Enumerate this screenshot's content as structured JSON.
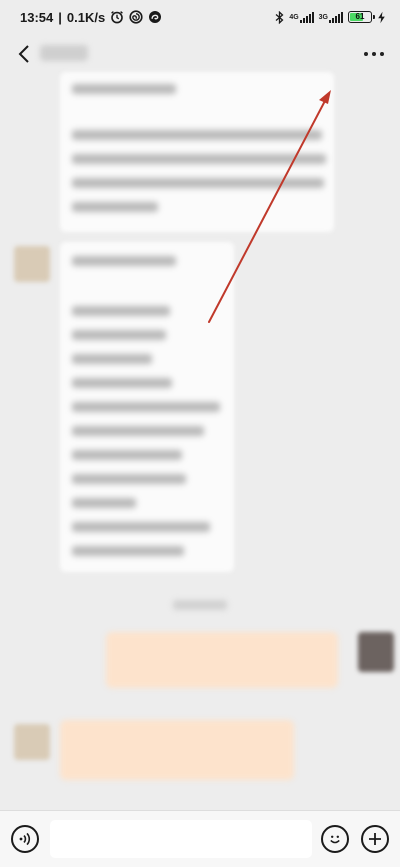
{
  "status_bar": {
    "time": "13:54",
    "net_speed": "0.1K/s",
    "separator": "|",
    "sim1_type": "4G",
    "sim2_type": "3G",
    "battery_level": "61"
  },
  "header": {
    "back_icon": "chevron-left-icon",
    "title": "",
    "more_icon": "more-horizontal-icon"
  },
  "colors": {
    "background": "#ededed",
    "received_bubble": "#fbfbfb",
    "sent_bubble": "#fde3cc",
    "annotation_arrow": "#c0392b",
    "battery_fill": "#4cd964"
  },
  "messages": [
    {
      "direction": "received",
      "content": "",
      "blurred": true
    },
    {
      "direction": "received",
      "content": "",
      "blurred": true,
      "list_lines": 10
    },
    {
      "direction": "time",
      "content": "",
      "blurred": true
    },
    {
      "direction": "sent",
      "content": "",
      "blurred": true
    },
    {
      "direction": "received",
      "content": "",
      "blurred": true
    }
  ],
  "annotation": {
    "type": "arrow",
    "points_to": "more-button"
  },
  "input_bar": {
    "voice_icon": "voice-icon",
    "input_value": "",
    "input_placeholder": "",
    "emoji_icon": "emoji-icon",
    "plus_icon": "plus-icon"
  }
}
